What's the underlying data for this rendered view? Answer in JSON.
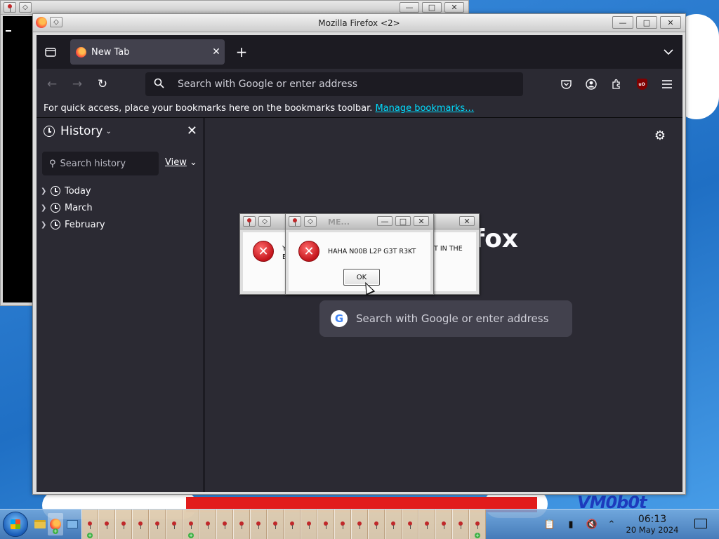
{
  "desktop": {
    "wallpaper_text": "VM0b0t"
  },
  "background_window": {
    "title": ""
  },
  "firefox": {
    "window_title": "Mozilla Firefox <2>",
    "tab": {
      "label": "New Tab"
    },
    "urlbar": {
      "placeholder": "Search with Google or enter address"
    },
    "bookmarks_bar": {
      "text": "For quick access, place your bookmarks here on the bookmarks toolbar.",
      "link": "Manage bookmarks…"
    },
    "sidebar": {
      "title": "History",
      "search_placeholder": "Search history",
      "view_label": "View",
      "items": [
        {
          "label": "Today"
        },
        {
          "label": "March"
        },
        {
          "label": "February"
        }
      ]
    },
    "newtab": {
      "brand_fragment": "efox",
      "search_placeholder": "Search with Google or enter address"
    }
  },
  "dialogs": {
    "back": {
      "title": "",
      "message_line1": "Y",
      "message_line1_right": "T IN THE",
      "message_line2": "E"
    },
    "front": {
      "title": "ME...",
      "message": "HAHA N00B L2P G3T R3KT",
      "ok_label": "OK"
    }
  },
  "taskbar": {
    "time": "06:13",
    "date": "20 May 2024"
  }
}
